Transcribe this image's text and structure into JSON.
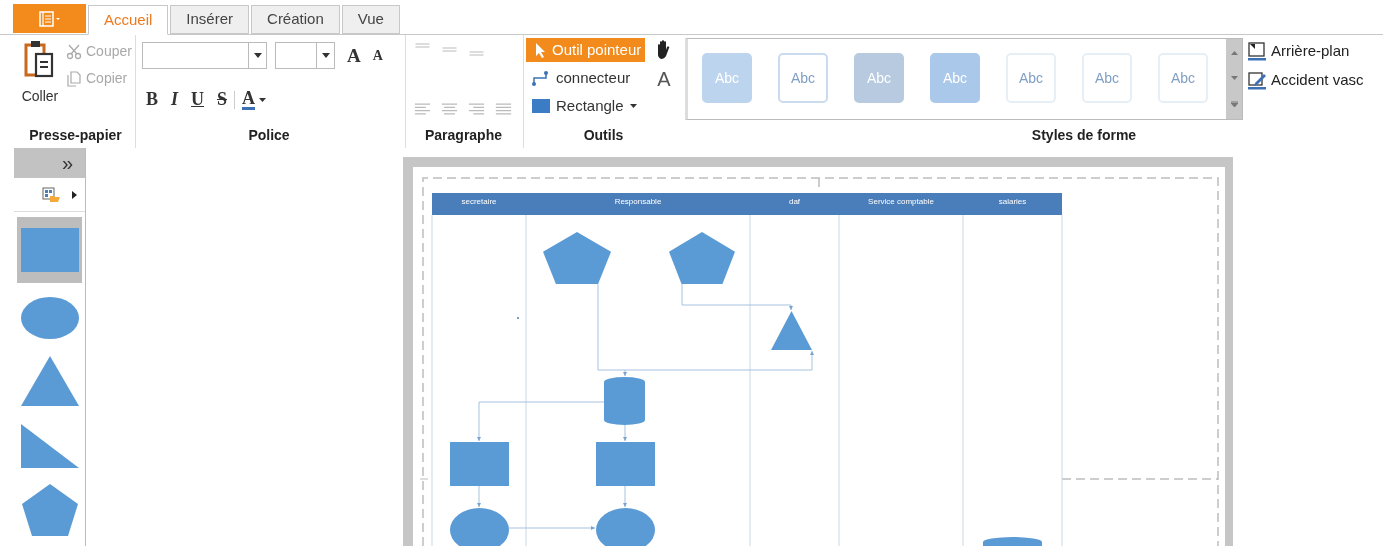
{
  "tabs": [
    {
      "label": "Accueil",
      "selected": true
    },
    {
      "label": "Insérer",
      "selected": false
    },
    {
      "label": "Création",
      "selected": false
    },
    {
      "label": "Vue",
      "selected": false
    }
  ],
  "clipboard": {
    "label": "Presse-papier",
    "paste": "Coller",
    "cut": {
      "label": "Couper",
      "disabled": true
    },
    "copy": {
      "label": "Copier",
      "disabled": true
    }
  },
  "font": {
    "label": "Police",
    "grow": "A",
    "shrink": "A",
    "format_buttons": [
      "B",
      "I",
      "U",
      "S"
    ],
    "color_button": "A"
  },
  "paragraph": {
    "label": "Paragraphe"
  },
  "tools": {
    "label": "Outils",
    "items": [
      {
        "label": "Outil pointeur",
        "kind": "pointer",
        "selected": true
      },
      {
        "label": "connecteur",
        "kind": "connector",
        "selected": false
      },
      {
        "label": "Rectangle",
        "kind": "rectangle",
        "selected": false
      }
    ],
    "text_tool": "A"
  },
  "shape_styles": {
    "label": "Styles de forme",
    "swatches": [
      {
        "label": "Abc",
        "kind": "fill",
        "color": "#bcd4ee"
      },
      {
        "label": "Abc",
        "kind": "outline",
        "color": "#c9dcef"
      },
      {
        "label": "Abc",
        "kind": "fill",
        "color": "#b7cadf"
      },
      {
        "label": "Abc",
        "kind": "fill",
        "color": "#a9c8ea"
      },
      {
        "label": "Abc",
        "kind": "outline",
        "color": "#e6eef6"
      },
      {
        "label": "Abc",
        "kind": "outline",
        "color": "#e6eef6"
      },
      {
        "label": "Abc",
        "kind": "outline",
        "color": "#e6eef6"
      }
    ]
  },
  "side_commands": [
    {
      "label": "Arrière-plan",
      "kind": "background"
    },
    {
      "label": "Accident vasc",
      "kind": "edit"
    }
  ],
  "shapes_panel": {
    "collapse": "»",
    "shapes": [
      {
        "kind": "rectangle",
        "selected": true
      },
      {
        "kind": "ellipse",
        "selected": false
      },
      {
        "kind": "triangle",
        "selected": false
      },
      {
        "kind": "right-triangle",
        "selected": false
      },
      {
        "kind": "pentagon",
        "selected": false
      }
    ]
  },
  "diagram": {
    "lanes": [
      {
        "title": "secretaire"
      },
      {
        "title": "Responsable"
      },
      {
        "title": "daf"
      },
      {
        "title": "Service comptable"
      },
      {
        "title": "salaries"
      }
    ],
    "nodes": [
      {
        "kind": "pentagon"
      },
      {
        "kind": "pentagon"
      },
      {
        "kind": "triangle"
      },
      {
        "kind": "cylinder"
      },
      {
        "kind": "rectangle"
      },
      {
        "kind": "rectangle"
      },
      {
        "kind": "ellipse"
      },
      {
        "kind": "ellipse"
      },
      {
        "kind": "cylinder"
      }
    ]
  }
}
